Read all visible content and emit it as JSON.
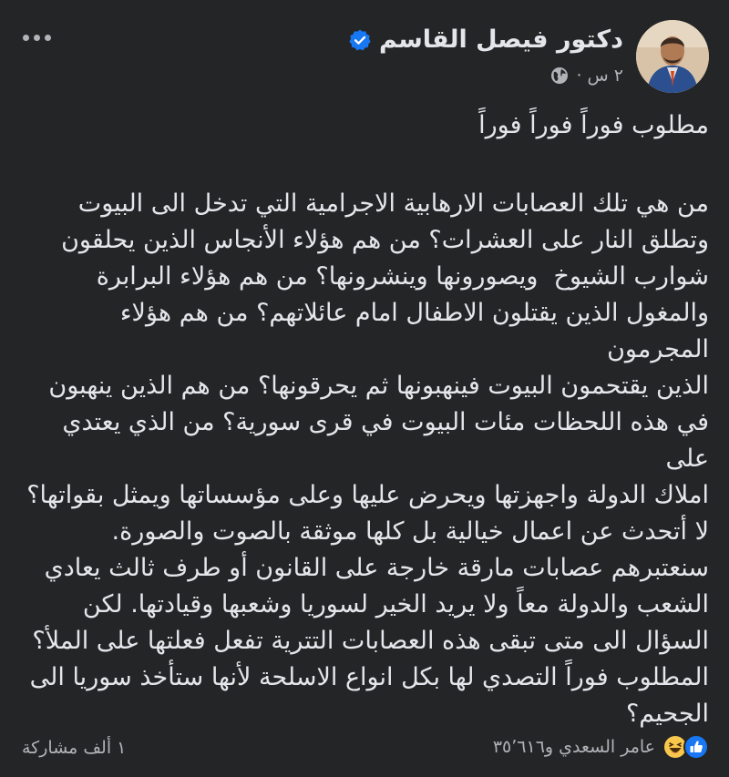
{
  "post": {
    "author": "دكتور فيصل القاسم",
    "time": "٢ س ·",
    "icons": {
      "verified": "verified-badge-icon",
      "audience": "globe-icon",
      "more": "more-options-icon"
    },
    "lines": [
      "مطلوب فوراً فوراً فوراً",
      "",
      "من هي تلك العصابات الارهابية الاجرامية التي تدخل الى البيوت",
      "وتطلق النار على العشرات؟ من هم هؤلاء الأنجاس الذين يحلقون",
      "شوارب الشيوخ  ويصورونها وينشرونها؟ من هم هؤلاء البرابرة",
      "والمغول الذين يقتلون الاطفال امام عائلاتهم؟ من هم هؤلاء المجرمون",
      "الذين يقتحمون البيوت فينهبونها ثم يحرقونها؟ من هم الذين ينهبون",
      "في هذه اللحظات مئات البيوت في قرى سورية؟ من الذي يعتدي على",
      "املاك الدولة واجهزتها ويحرض عليها وعلى مؤسساتها ويمثل بقواتها؟",
      "لا أتحدث عن اعمال خيالية بل كلها موثقة بالصوت والصورة.",
      "سنعتبرهم عصابات مارقة خارجة على القانون أو طرف ثالث يعادي",
      "الشعب والدولة معاً ولا يريد الخير لسوريا وشعبها وقيادتها. لكن",
      "السؤال الى متى تبقى هذه العصابات التترية تفعل فعلتها على الملأ؟",
      "المطلوب فوراً التصدي لها بكل انواع الاسلحة لأنها ستأخذ سوريا الى",
      "الجحيم؟"
    ]
  },
  "footer": {
    "reactions_text": "عامر السعدي و٣٥٬٦١٦",
    "reaction_icons": [
      "like-reaction-icon",
      "haha-reaction-icon"
    ],
    "shares_text": "١ ألف مشاركة"
  },
  "colors": {
    "background": "#242526",
    "text": "#e4e6eb",
    "secondary": "#b0b3b8",
    "accent": "#1877f2"
  }
}
